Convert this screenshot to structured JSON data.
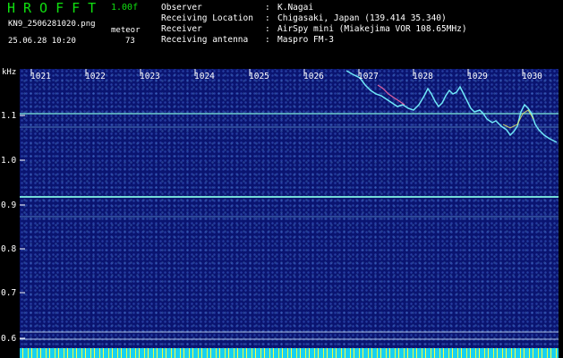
{
  "header": {
    "brand": "HROFFT",
    "version": "1.00f",
    "filename": "KN9_2506281020.png",
    "datetime": "25.06.28 10:20",
    "counter_label": "meteor",
    "counter_value": "73"
  },
  "meta": [
    {
      "key": "Observer",
      "value": "K.Nagai"
    },
    {
      "key": "Receiving Location",
      "value": "Chigasaki, Japan (139.414 35.340)"
    },
    {
      "key": "Receiver",
      "value": "AirSpy mini (Miakejima VOR 108.65MHz)"
    },
    {
      "key": "Receiving antenna",
      "value": "Maspro FM-3"
    }
  ],
  "axes": {
    "y_unit": "kHz",
    "y_ticks": [
      "1.1",
      "1.0",
      "0.9",
      "0.8",
      "0.7",
      "0.6"
    ],
    "x_ticks": [
      "1021",
      "1022",
      "1023",
      "1024",
      "1025",
      "1026",
      "1027",
      "1028",
      "1029",
      "1030"
    ]
  },
  "colors": {
    "background": "#000000",
    "plot_bg": "#0a1470",
    "brand": "#10e010",
    "carrier": "#80f0e0"
  }
}
